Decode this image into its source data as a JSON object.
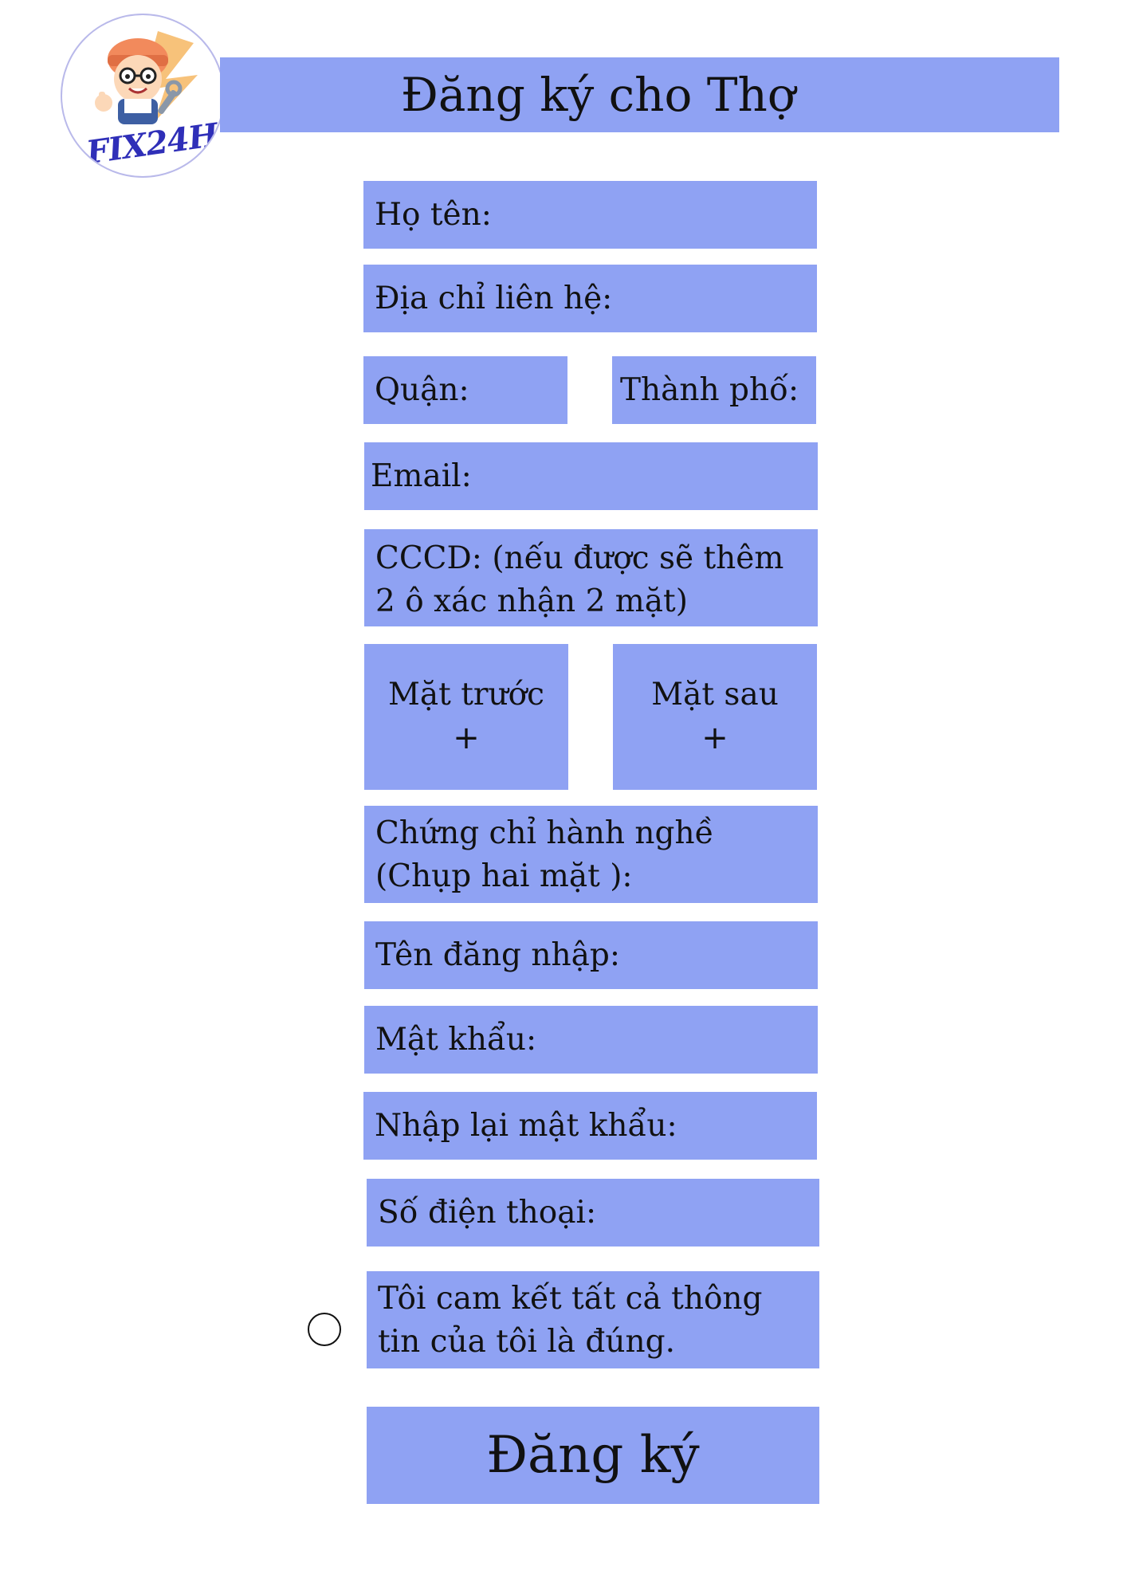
{
  "header": {
    "title": "Đăng ký cho Thợ"
  },
  "logo": {
    "text": "FIX24H"
  },
  "form": {
    "full_name": "Họ tên:",
    "address": "Địa chỉ liên hệ:",
    "district": "Quận:",
    "city": "Thành phố:",
    "email": "Email:",
    "cccd_line1": "CCCD: (nếu được sẽ thêm",
    "cccd_line2": "2 ô xác nhận 2 mặt)",
    "front_side": "Mặt trước",
    "back_side": "Mặt sau",
    "plus": "+",
    "certificate_line1": "Chứng chỉ hành nghề",
    "certificate_line2": "(Chụp hai mặt ):",
    "username": "Tên đăng nhập:",
    "password": "Mật khẩu:",
    "confirm_password": "Nhập lại mật khẩu:",
    "phone": "Số điện thoại:",
    "commit_line1": "Tôi cam kết tất cả thông",
    "commit_line2": "tin của tôi là đúng.",
    "submit": "Đăng ký"
  },
  "colors": {
    "field_bg": "#8fa2f3",
    "logo_text": "#2f2fb8"
  }
}
